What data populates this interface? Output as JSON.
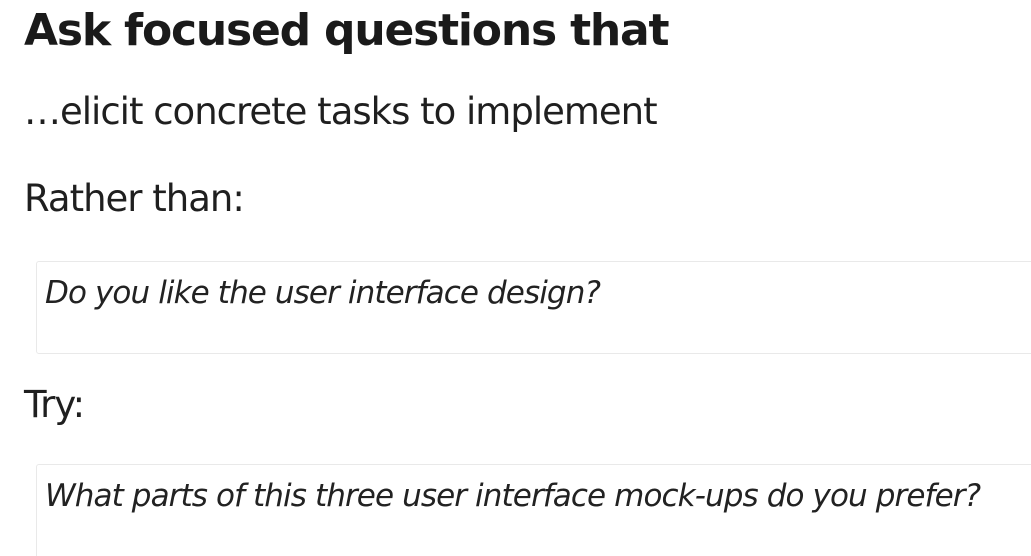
{
  "heading": "Ask focused questions that",
  "subtitle": "…elicit concrete tasks to implement",
  "rather_than": {
    "label": "Rather than:",
    "example": "Do you like the user interface design?"
  },
  "try": {
    "label": "Try:",
    "example": "What parts of this three user interface mock-ups do you prefer?"
  }
}
